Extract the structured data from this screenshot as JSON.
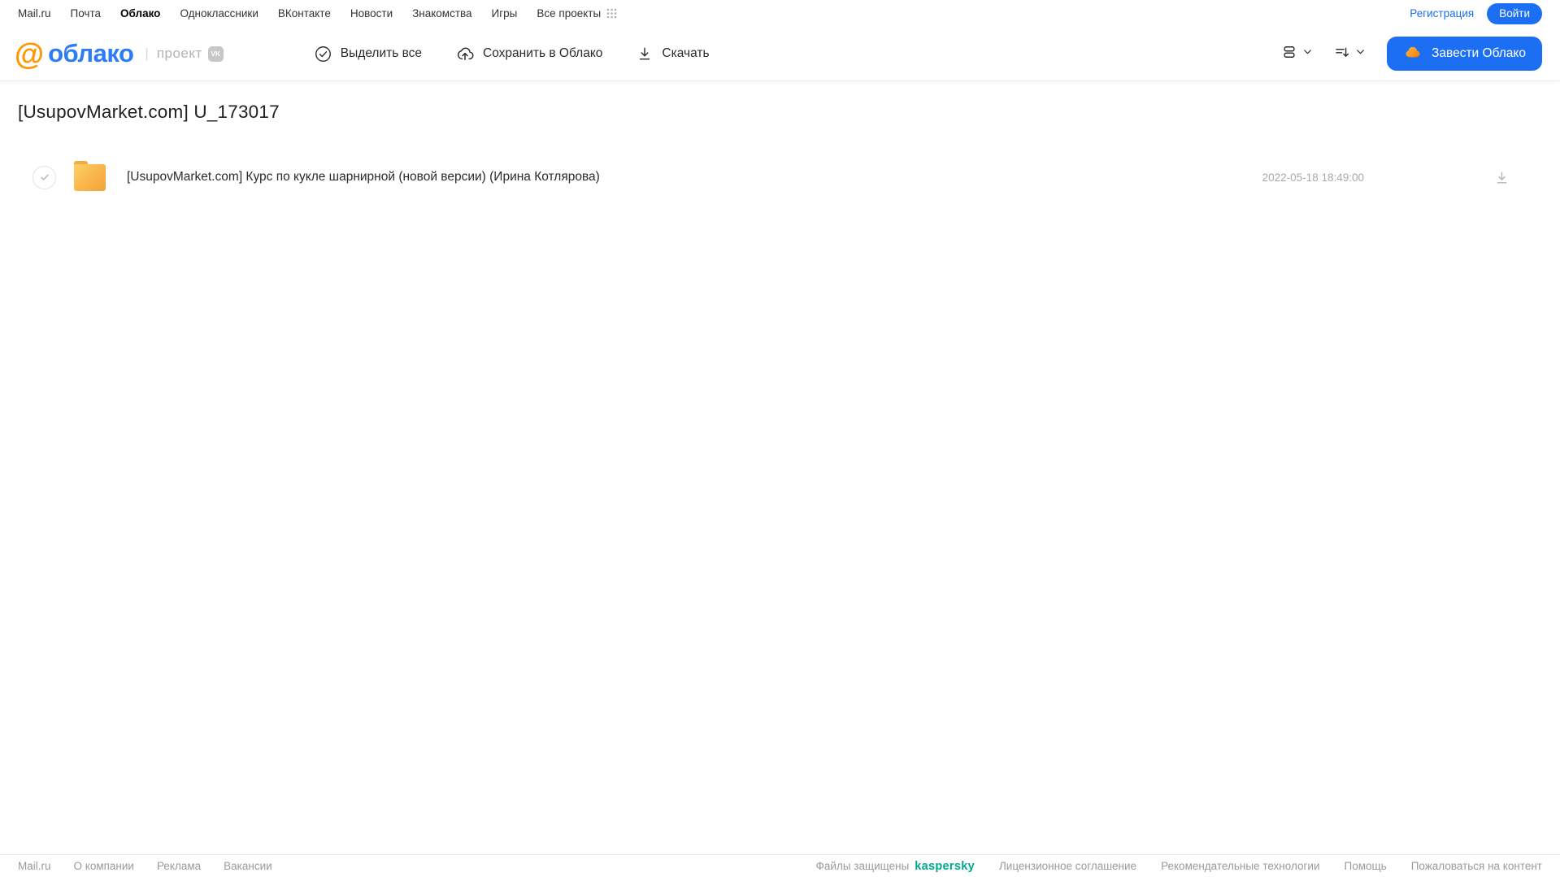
{
  "topnav": {
    "links": [
      "Mail.ru",
      "Почта",
      "Облако",
      "Одноклассники",
      "ВКонтакте",
      "Новости",
      "Знакомства",
      "Игры",
      "Все проекты"
    ],
    "registration_label": "Регистрация",
    "login_label": "Войти"
  },
  "header": {
    "logo_at": "@",
    "logo_word": "облако",
    "logo_separator": "|",
    "project_label": "проект",
    "vk_badge": "VK",
    "actions": {
      "select_all": "Выделить все",
      "save_to_cloud": "Сохранить в Облако",
      "download": "Скачать"
    },
    "get_cloud_label": "Завести Облако"
  },
  "main": {
    "title": "[UsupovMarket.com] U_173017",
    "files": [
      {
        "name": "[UsupovMarket.com] Курс по кукле шарнирной (новой версии) (Ирина Котлярова)",
        "date": "2022-05-18 18:49:00"
      }
    ]
  },
  "footer": {
    "left_links": [
      "Mail.ru",
      "О компании",
      "Реклама",
      "Вакансии"
    ],
    "protected_label": "Файлы защищены",
    "kaspersky_label": "kaspersky",
    "right_links": [
      "Лицензионное соглашение",
      "Рекомендательные технологии",
      "Помощь",
      "Пожаловаться на контент"
    ]
  },
  "colors": {
    "accent_blue": "#1c6ef2",
    "logo_blue": "#2c7cf6",
    "logo_orange": "#ff9800",
    "folder_orange": "#f9b44a",
    "kaspersky_green": "#00a88e"
  }
}
